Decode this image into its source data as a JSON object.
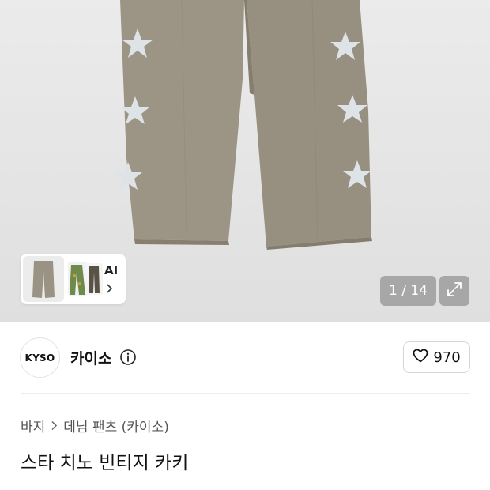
{
  "gallery": {
    "counter": "1 / 14",
    "ai_label": "AI",
    "icons": {
      "expand": "expand-icon",
      "chevron": "chevron-right-icon"
    }
  },
  "brand": {
    "logo_text": "KYSO",
    "name": "카이소",
    "like_count": "970",
    "icons": {
      "info": "info-icon",
      "heart": "heart-outline-icon"
    }
  },
  "breadcrumb": {
    "items": [
      "바지",
      "데님 팬츠 (카이소)"
    ]
  },
  "product": {
    "title": "스타 치노 빈티지 카키"
  },
  "colors": {
    "pants": "#9a9383",
    "star": "#dfe5e8",
    "hero_bg": "#e5e5e5",
    "overlay": "#7c7c7c"
  }
}
